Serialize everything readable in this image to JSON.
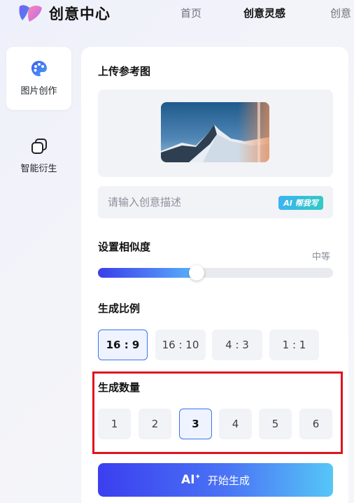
{
  "header": {
    "brand": "创意中心",
    "nav": [
      "首页",
      "创意灵感",
      "创意"
    ]
  },
  "sidebar": {
    "items": [
      {
        "label": "图片创作",
        "icon": "palette-icon"
      },
      {
        "label": "智能衍生",
        "icon": "copy-icon"
      }
    ]
  },
  "upload": {
    "title": "上传参考图"
  },
  "description": {
    "placeholder": "请输入创意描述",
    "ai_badge": "AI 帮我写"
  },
  "similarity": {
    "title": "设置相似度",
    "level": "中等",
    "value_fraction": 0.42
  },
  "ratio": {
    "title": "生成比例",
    "options": [
      "16 : 9",
      "16 : 10",
      "4 : 3",
      "1 : 1"
    ],
    "selected": "16 : 9"
  },
  "count": {
    "title": "生成数量",
    "options": [
      "1",
      "2",
      "3",
      "4",
      "5",
      "6"
    ],
    "selected": "3"
  },
  "generate": {
    "ai_label": "AI",
    "label": "开始生成"
  },
  "colors": {
    "accent": "#3a74f0",
    "highlight": "#e0141e"
  }
}
